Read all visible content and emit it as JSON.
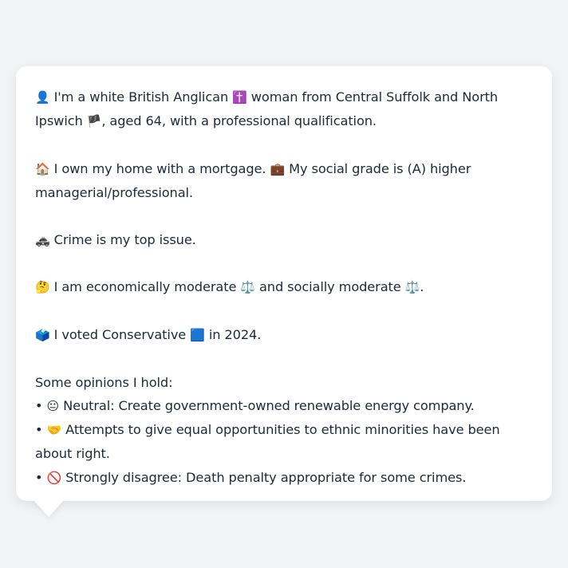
{
  "bio": {
    "identity": {
      "icon": "👤",
      "pre": "I'm a white British Anglican",
      "religion_icon": "✝️",
      "mid": "woman from Central Suffolk and North Ipswich",
      "flag_icon": "🏴",
      "post": ", aged 64, with a professional qualification."
    },
    "home": {
      "icon": "🏠",
      "text1": "I own my home with a mortgage.",
      "grade_icon": "💼",
      "text2": "My social grade is (A) higher managerial/professional."
    },
    "issue": {
      "icon": "🚓",
      "text": "Crime is my top issue."
    },
    "ideology": {
      "icon": "🤔",
      "text1": "I am economically moderate",
      "econ_icon": "⚖️",
      "text2": "and socially moderate",
      "soc_icon": "⚖️",
      "text3": "."
    },
    "vote": {
      "icon": "🗳️",
      "text1": "I voted Conservative",
      "party_icon": "🟦",
      "text2": "in 2024."
    },
    "opinions": {
      "heading": "Some opinions I hold:",
      "items": [
        {
          "bullet": "•",
          "icon": "😐",
          "text": "Neutral: Create government-owned renewable energy company."
        },
        {
          "bullet": "•",
          "icon": "🤝",
          "text": "Attempts to give equal opportunities to ethnic minorities have been about right."
        },
        {
          "bullet": "•",
          "icon": "🚫",
          "text": "Strongly disagree: Death penalty appropriate for some crimes."
        }
      ]
    }
  },
  "colors": {
    "background": "#f2f3f5",
    "card": "#ffffff",
    "text": "#1f2937"
  }
}
